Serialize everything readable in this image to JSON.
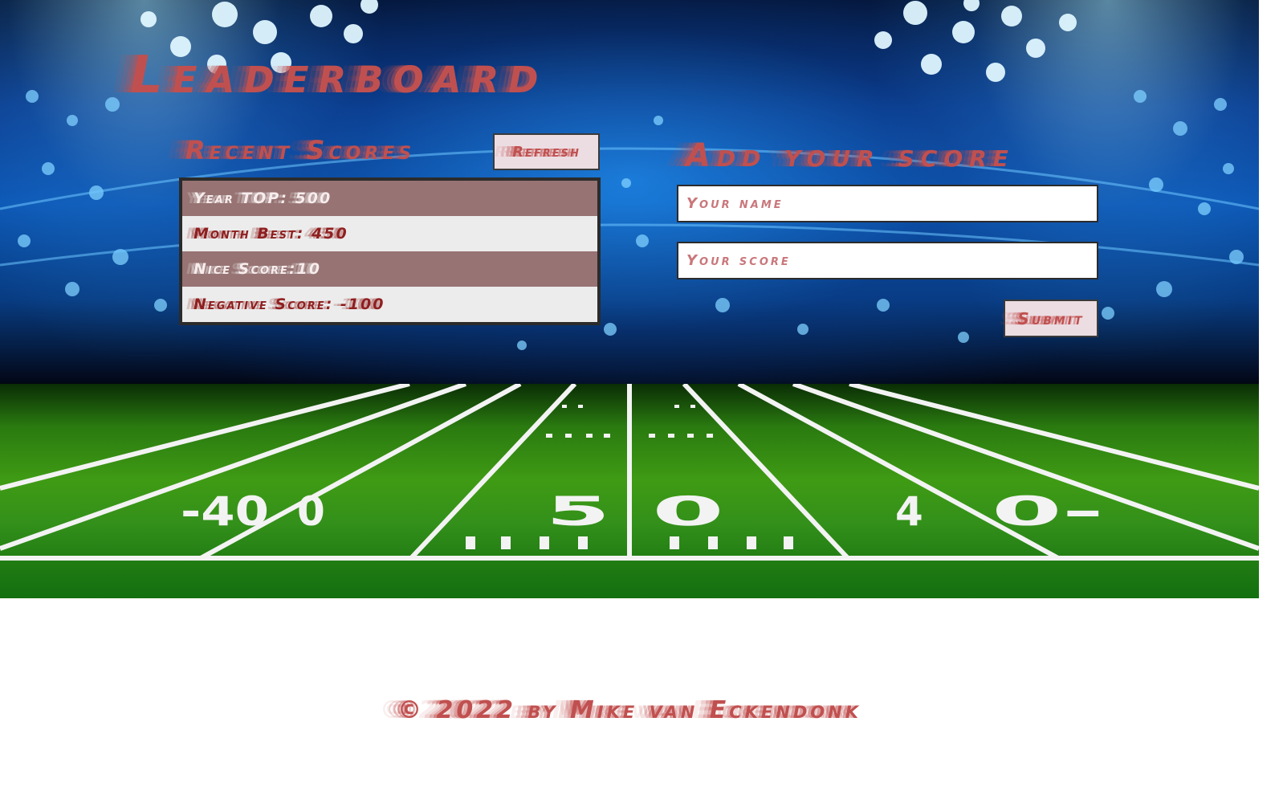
{
  "page": {
    "title": "Leaderboard"
  },
  "recent": {
    "heading": "Recent Scores",
    "refresh_label": "Refresh",
    "scores": [
      "Year TOP: 500",
      "Month Best: 450",
      "Nice Score:10",
      "Negative Score: -100"
    ]
  },
  "add": {
    "heading": "Add your score",
    "name_placeholder": "Your name",
    "score_placeholder": "Your score",
    "submit_label": "Submit"
  },
  "footer": {
    "text": "© 2022 by Mike van Eckendonk"
  },
  "colors": {
    "accent": "#c0504f",
    "row_dark": "#977373",
    "row_light": "#ececec"
  }
}
